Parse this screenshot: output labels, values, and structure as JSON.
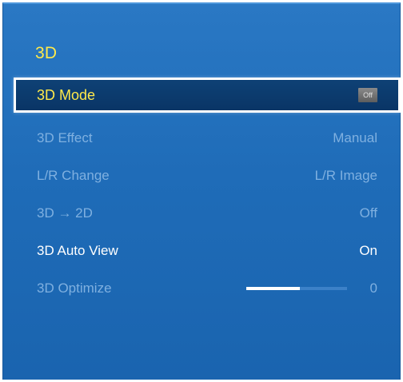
{
  "menu": {
    "title": "3D",
    "items": [
      {
        "label": "3D Mode",
        "value": "Off",
        "state": "selected",
        "value_type": "badge"
      },
      {
        "label": "3D Effect",
        "value": "Manual",
        "state": "disabled"
      },
      {
        "label": "L/R Change",
        "value": "L/R Image",
        "state": "disabled"
      },
      {
        "label": "3D → 2D",
        "value": "Off",
        "state": "disabled"
      },
      {
        "label": "3D Auto View",
        "value": "On",
        "state": "enabled"
      },
      {
        "label": "3D Optimize",
        "value": "0",
        "state": "disabled",
        "slider_fraction": 0.53
      }
    ]
  },
  "colors": {
    "highlight_text": "#ffe94a",
    "panel_blue": "#1f6cb8",
    "selected_bg": "#0a3566",
    "disabled_text": "#7fb0e0"
  }
}
